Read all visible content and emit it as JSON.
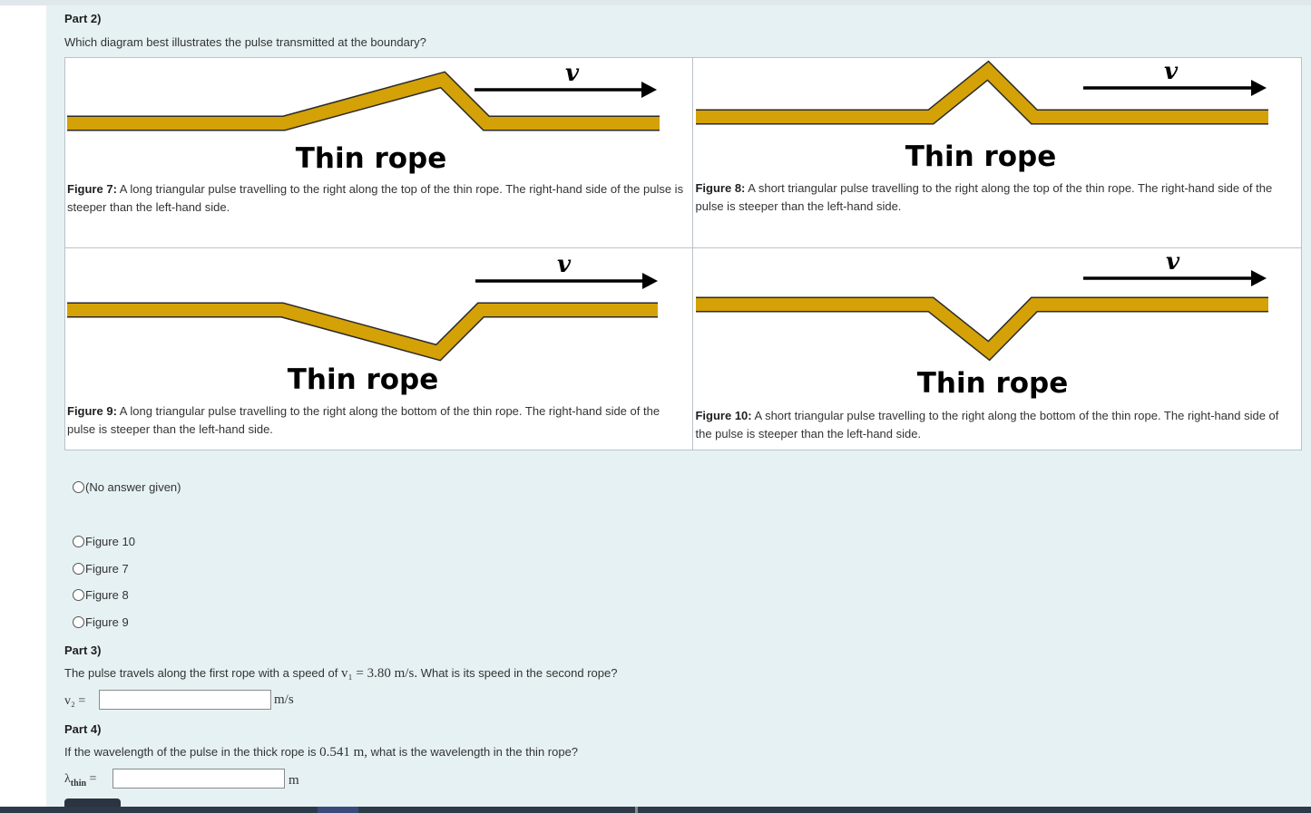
{
  "part2": {
    "title": "Part 2)",
    "question": "Which diagram best illustrates the pulse transmitted at the boundary?",
    "figures": [
      {
        "image_label": "Thin rope",
        "velocity_symbol": "v",
        "caption_bold": "Figure 7:",
        "caption": " A long triangular pulse travelling to the right along the top of the thin rope. The right-hand side of the pulse is steeper than the left-hand side."
      },
      {
        "image_label": "Thin rope",
        "velocity_symbol": "v",
        "caption_bold": "Figure 8:",
        "caption": " A short triangular pulse travelling to the right along the top of the thin rope. The right-hand side of the pulse is steeper than the left-hand side."
      },
      {
        "image_label": "Thin rope",
        "velocity_symbol": "v",
        "caption_bold": "Figure 9:",
        "caption": " A long triangular pulse travelling to the right along the bottom of the thin rope. The right-hand side of the pulse is steeper than the left-hand side."
      },
      {
        "image_label": "Thin rope",
        "velocity_symbol": "v",
        "caption_bold": "Figure 10:",
        "caption": " A short triangular pulse travelling to the right along the bottom of the thin rope. The right-hand side of the pulse is steeper than the left-hand side."
      }
    ],
    "options": [
      "(No answer given)",
      "Figure 10",
      "Figure 7",
      "Figure 8",
      "Figure 9"
    ]
  },
  "part3": {
    "title": "Part 3)",
    "question_prefix": "The pulse travels along the first rope with a speed of ",
    "math_speed": "v₁ = 3.80 m/s.",
    "question_suffix": " What is its speed in the second rope?",
    "input_label": "v₂ =",
    "input_value": "",
    "unit": "m/s"
  },
  "part4": {
    "title": "Part 4)",
    "question_prefix": "If the wavelength of the pulse in the thick rope is ",
    "math_length": "0.541 m,",
    "question_suffix": " what is the wavelength in the thin rope?",
    "input_label": "λ",
    "input_label_sub": "thin",
    "input_label_eq": " =",
    "input_value": "",
    "unit": "m"
  },
  "colors": {
    "rope": "#d4a107",
    "rope_outline": "#2a2a2a",
    "panel_bg": "#e6f1f3"
  }
}
